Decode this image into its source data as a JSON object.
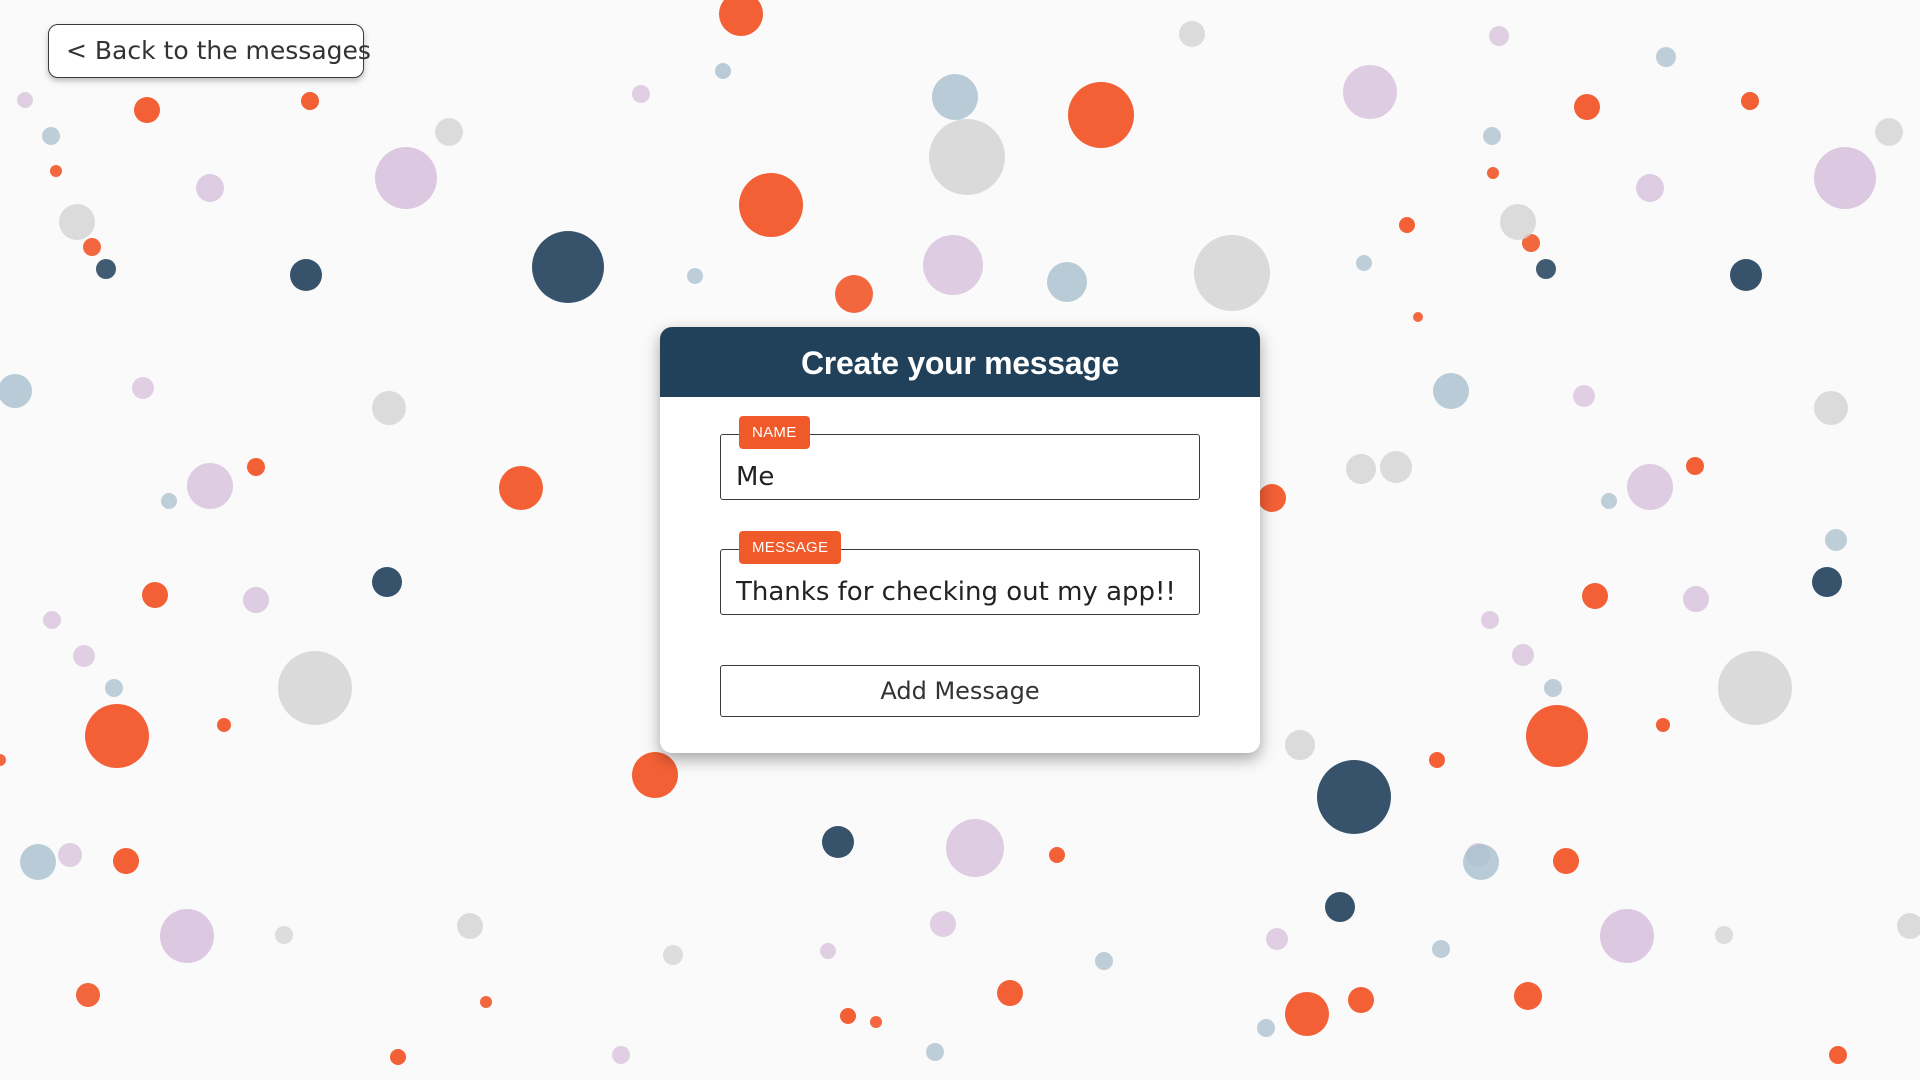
{
  "back_button": {
    "label": "< Back to the messages"
  },
  "card": {
    "title": "Create your message",
    "fields": [
      {
        "tag": "NAME",
        "value": "Me"
      },
      {
        "tag": "MESSAGE",
        "value": "Thanks for checking out my app!!"
      }
    ],
    "submit_label": "Add Message"
  },
  "colors": {
    "background": "#fafafa",
    "header": "#21415a",
    "accent": "#f05a2a",
    "dot_orange": "#f2572a",
    "dot_navy": "#2c4a63",
    "dot_lilac": "#d4bcd9",
    "dot_gray": "#d3d3d3",
    "dot_blue_gray": "#a9bfcd"
  }
}
